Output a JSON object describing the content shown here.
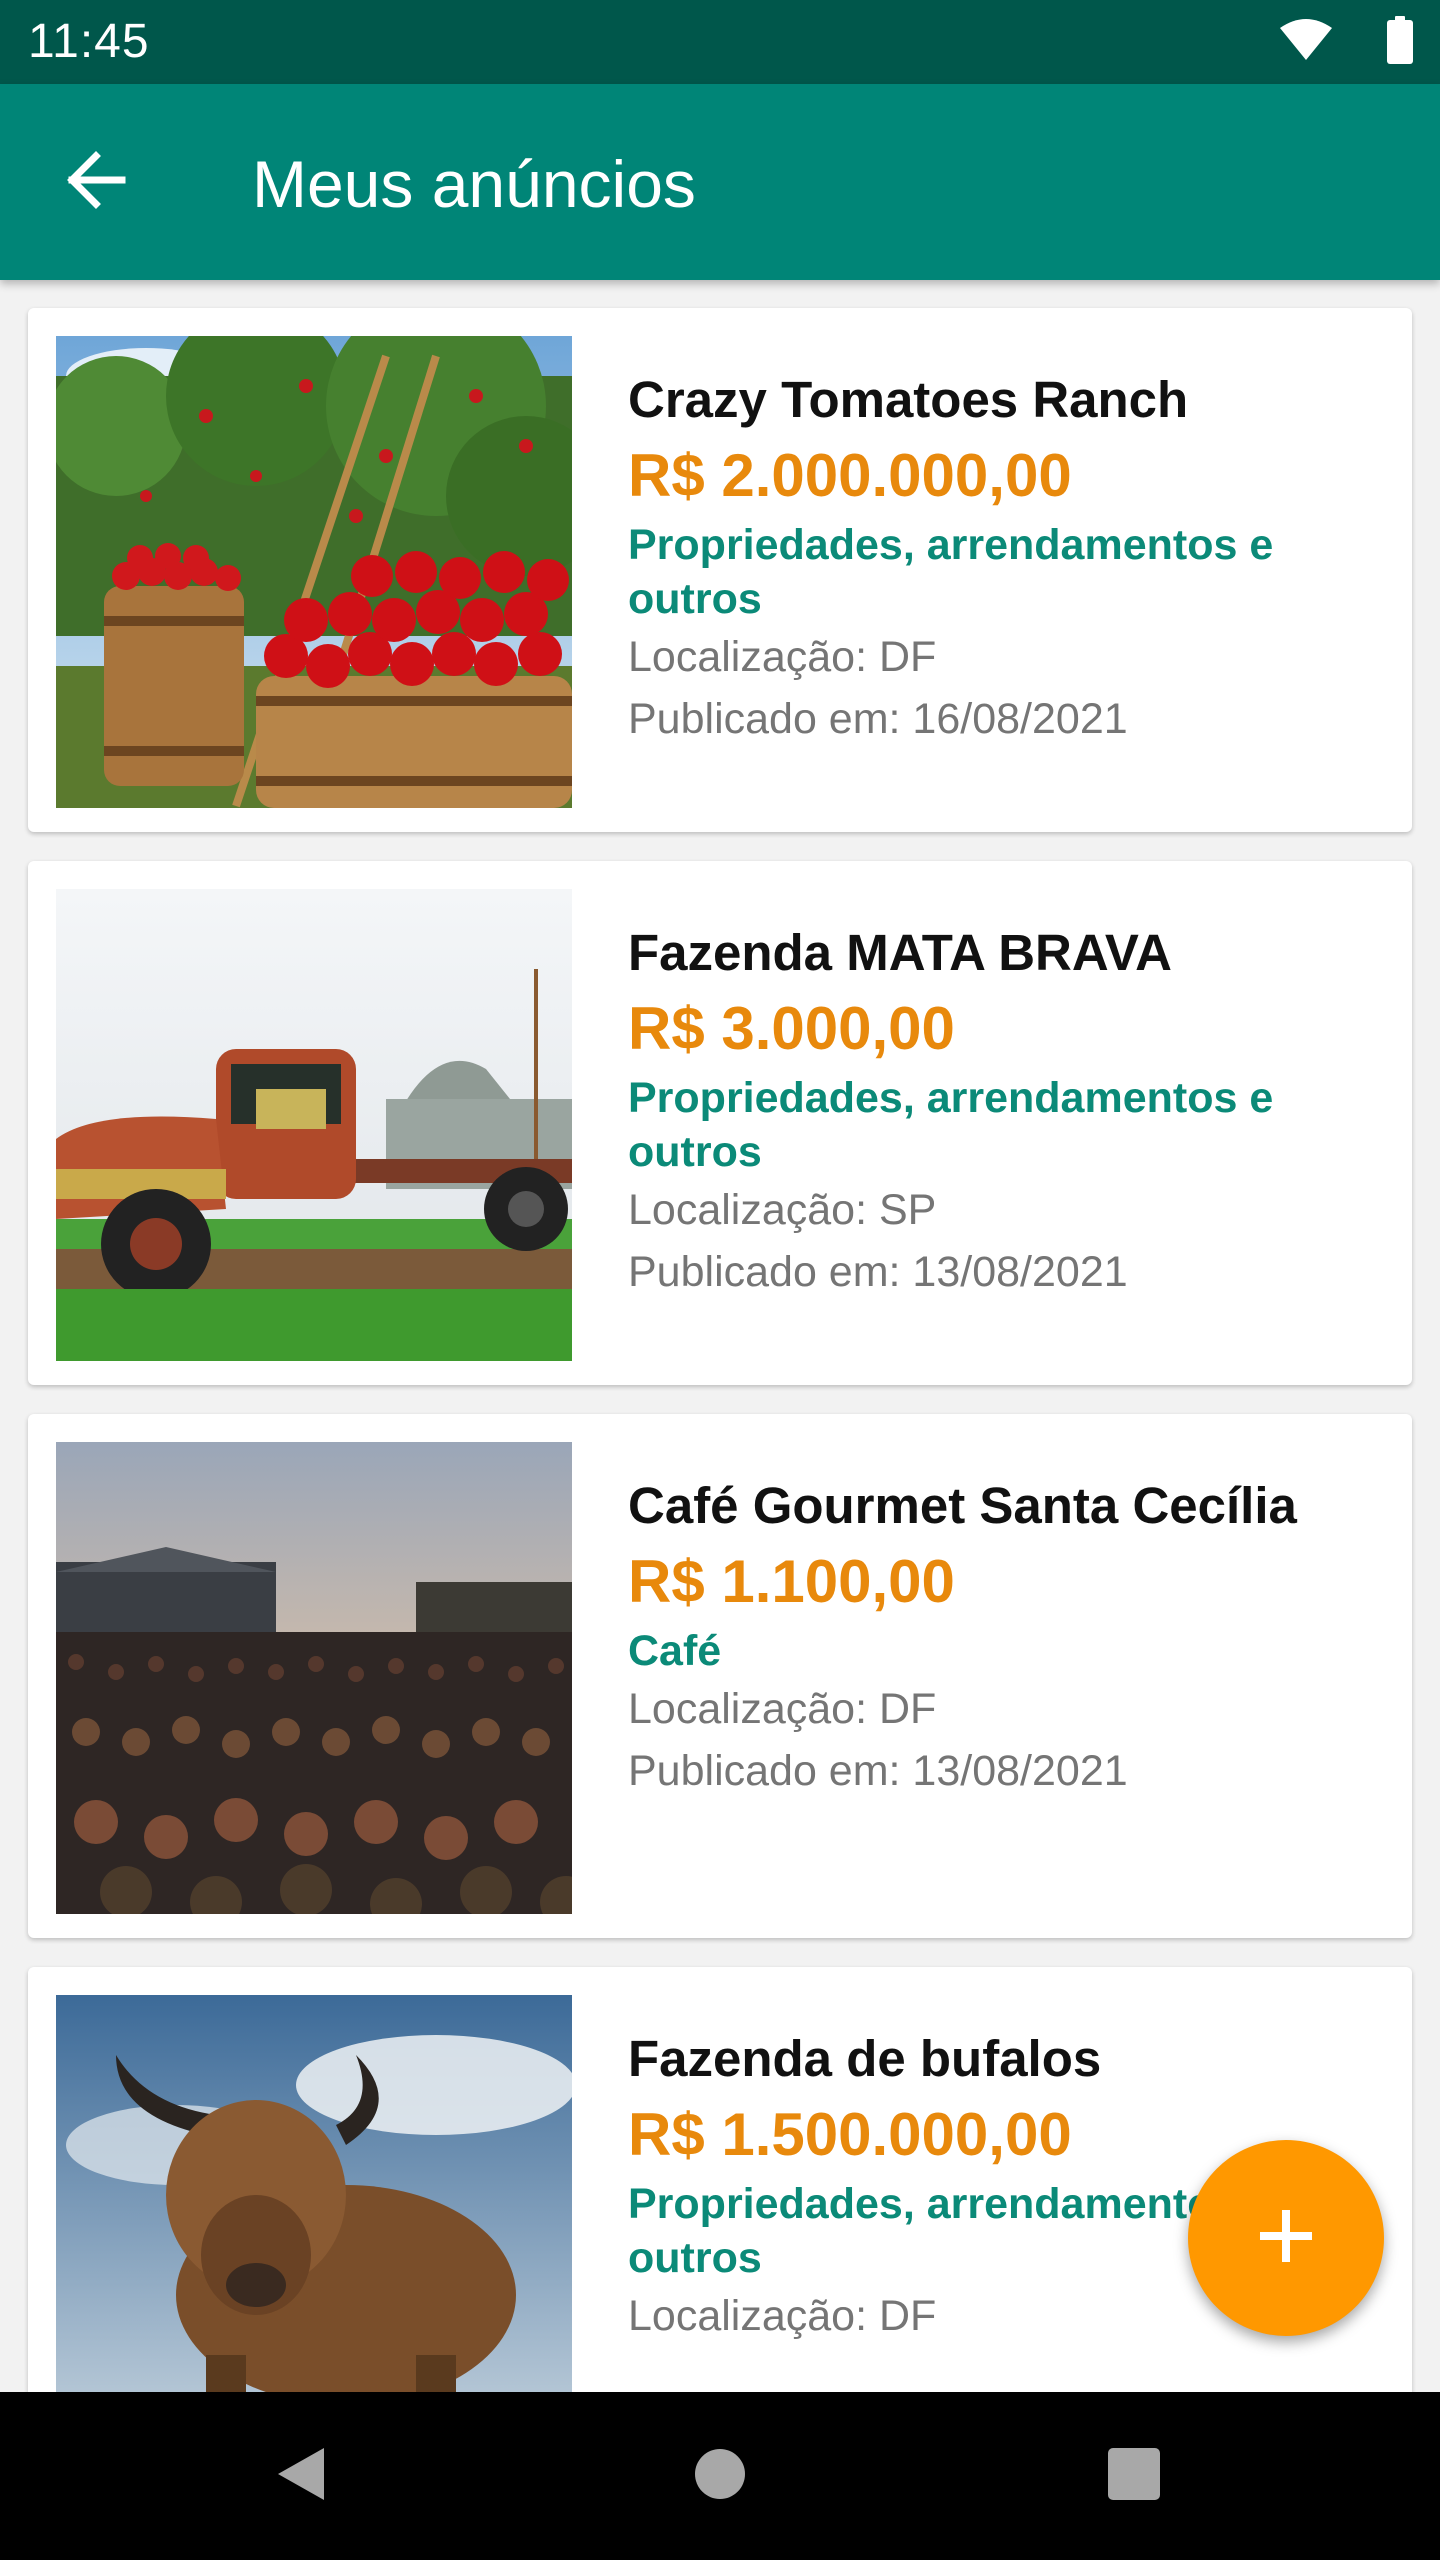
{
  "status_bar": {
    "time": "11:45",
    "icons": [
      "wifi-icon",
      "battery-icon"
    ]
  },
  "app_bar": {
    "title": "Meus anúncios",
    "back_icon": "arrow-back-icon"
  },
  "colors": {
    "status_bar": "#00574b",
    "app_bar": "#008577",
    "price": "#e8890c",
    "category": "#0b8a78",
    "fab": "#ff9800"
  },
  "listings": [
    {
      "title": "Crazy Tomatoes Ranch",
      "price": "R$ 2.000.000,00",
      "category": "Propriedades, arrendamentos e outros",
      "location": "Localização: DF",
      "published": "Publicado em: 16/08/2021",
      "image": "apples-in-barrels-photo"
    },
    {
      "title": "Fazenda MATA BRAVA",
      "price": "R$ 3.000,00",
      "category": "Propriedades, arrendamentos e outros",
      "location": "Localização: SP",
      "published": "Publicado em: 13/08/2021",
      "image": "rusty-truck-photo"
    },
    {
      "title": "Café Gourmet Santa Cecília",
      "price": "R$ 1.100,00",
      "category": "Café",
      "location": "Localização: DF",
      "published": "Publicado em: 13/08/2021",
      "image": "coffee-beans-photo"
    },
    {
      "title": "Fazenda de bufalos",
      "price": "R$ 1.500.000,00",
      "category": "Propriedades, arrendamentos e outros",
      "location": "Localização: DF",
      "published": "",
      "image": "highland-cattle-photo"
    }
  ],
  "fab": {
    "icon": "plus-icon"
  },
  "nav_bar": {
    "buttons": [
      "back-triangle-icon",
      "home-circle-icon",
      "recents-square-icon"
    ]
  }
}
